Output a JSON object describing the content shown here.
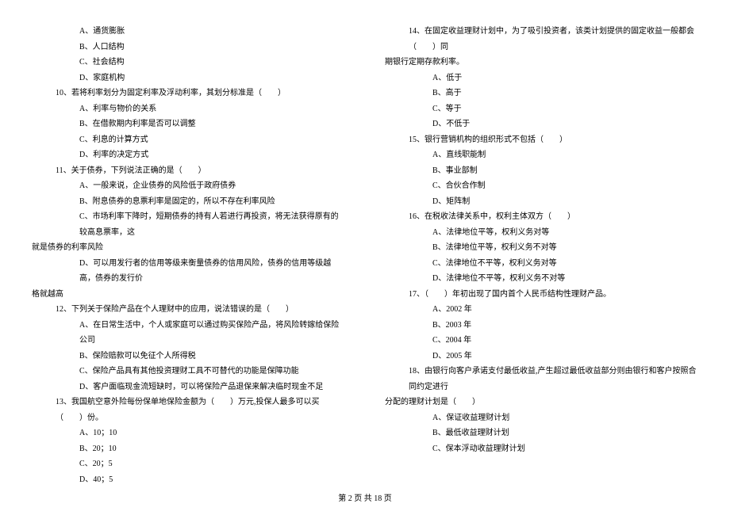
{
  "leftColumn": {
    "opts9": [
      "A、通货膨胀",
      "B、人口结构",
      "C、社会结构",
      "D、家庭机构"
    ],
    "q10": "10、若将利率划分为固定利率及浮动利率，其划分标准是（　　）",
    "opts10": [
      "A、利率与物价的关系",
      "B、在借款期内利率是否可以调整",
      "C、利息的计算方式",
      "D、利率的决定方式"
    ],
    "q11": "11、关于债券，下列说法正确的是（　　）",
    "opts11a": [
      "A、一般来说，企业债券的风险低于政府债券",
      "B、附息债券的息票利率是固定的，所以不存在利率风险",
      "C、市场利率下降时，短期债券的持有人若进行再投资，将无法获得原有的较高息票率，这"
    ],
    "cont11c": "就是债券的利率风险",
    "opts11d": "D、可以用发行者的信用等级来衡量债券的信用风险，债券的信用等级越高，债券的发行价",
    "cont11d": "格就越高",
    "q12": "12、下列关于保险产品在个人理财中的应用，说法错误的是（　　）",
    "opts12": [
      "A、在日常生活中，个人或家庭可以通过购买保险产品，将风险转嫁给保险公司",
      "B、保险赔款可以免征个人所得税",
      "C、保险产品具有其他投资理财工具不可替代的功能是保障功能",
      "D、客户面临现金流短缺时，可以将保险产品退保来解决临时现金不足"
    ],
    "q13": "13、我国航空意外险每份保单地保险金额为（　　）万元,投保人最多可以买（　　）份。",
    "opts13": [
      "A、10；10",
      "B、20；10",
      "C、20；5",
      "D、40；5"
    ]
  },
  "rightColumn": {
    "q14": "14、在固定收益理财计划中，为了吸引投资者，该类计划提供的固定收益一般都会（　　）同",
    "q14cont": "期银行定期存款利率。",
    "opts14": [
      "A、低于",
      "B、高于",
      "C、等于",
      "D、不低于"
    ],
    "q15": "15、银行营销机构的组织形式不包括（　　）",
    "opts15": [
      "A、直线职能制",
      "B、事业部制",
      "C、合伙合作制",
      "D、矩阵制"
    ],
    "q16": "16、在税收法律关系中，权利主体双方（　　）",
    "opts16": [
      "A、法律地位平等，权利义务对等",
      "B、法律地位平等，权利义务不对等",
      "C、法律地位不平等，权利义务对等",
      "D、法律地位不平等，权利义务不对等"
    ],
    "q17": "17、（　　）年初出现了国内首个人民币结构性理财产品。",
    "opts17": [
      "A、2002 年",
      "B、2003 年",
      "C、2004 年",
      "D、2005 年"
    ],
    "q18": "18、由银行向客户承诺支付最低收益,产生超过最低收益部分则由银行和客户按照合同约定进行",
    "q18cont": "分配的理财计划是（　　）",
    "opts18": [
      "A、保证收益理财计划",
      "B、最低收益理财计划",
      "C、保本浮动收益理财计划"
    ]
  },
  "footer": "第 2 页 共 18 页"
}
